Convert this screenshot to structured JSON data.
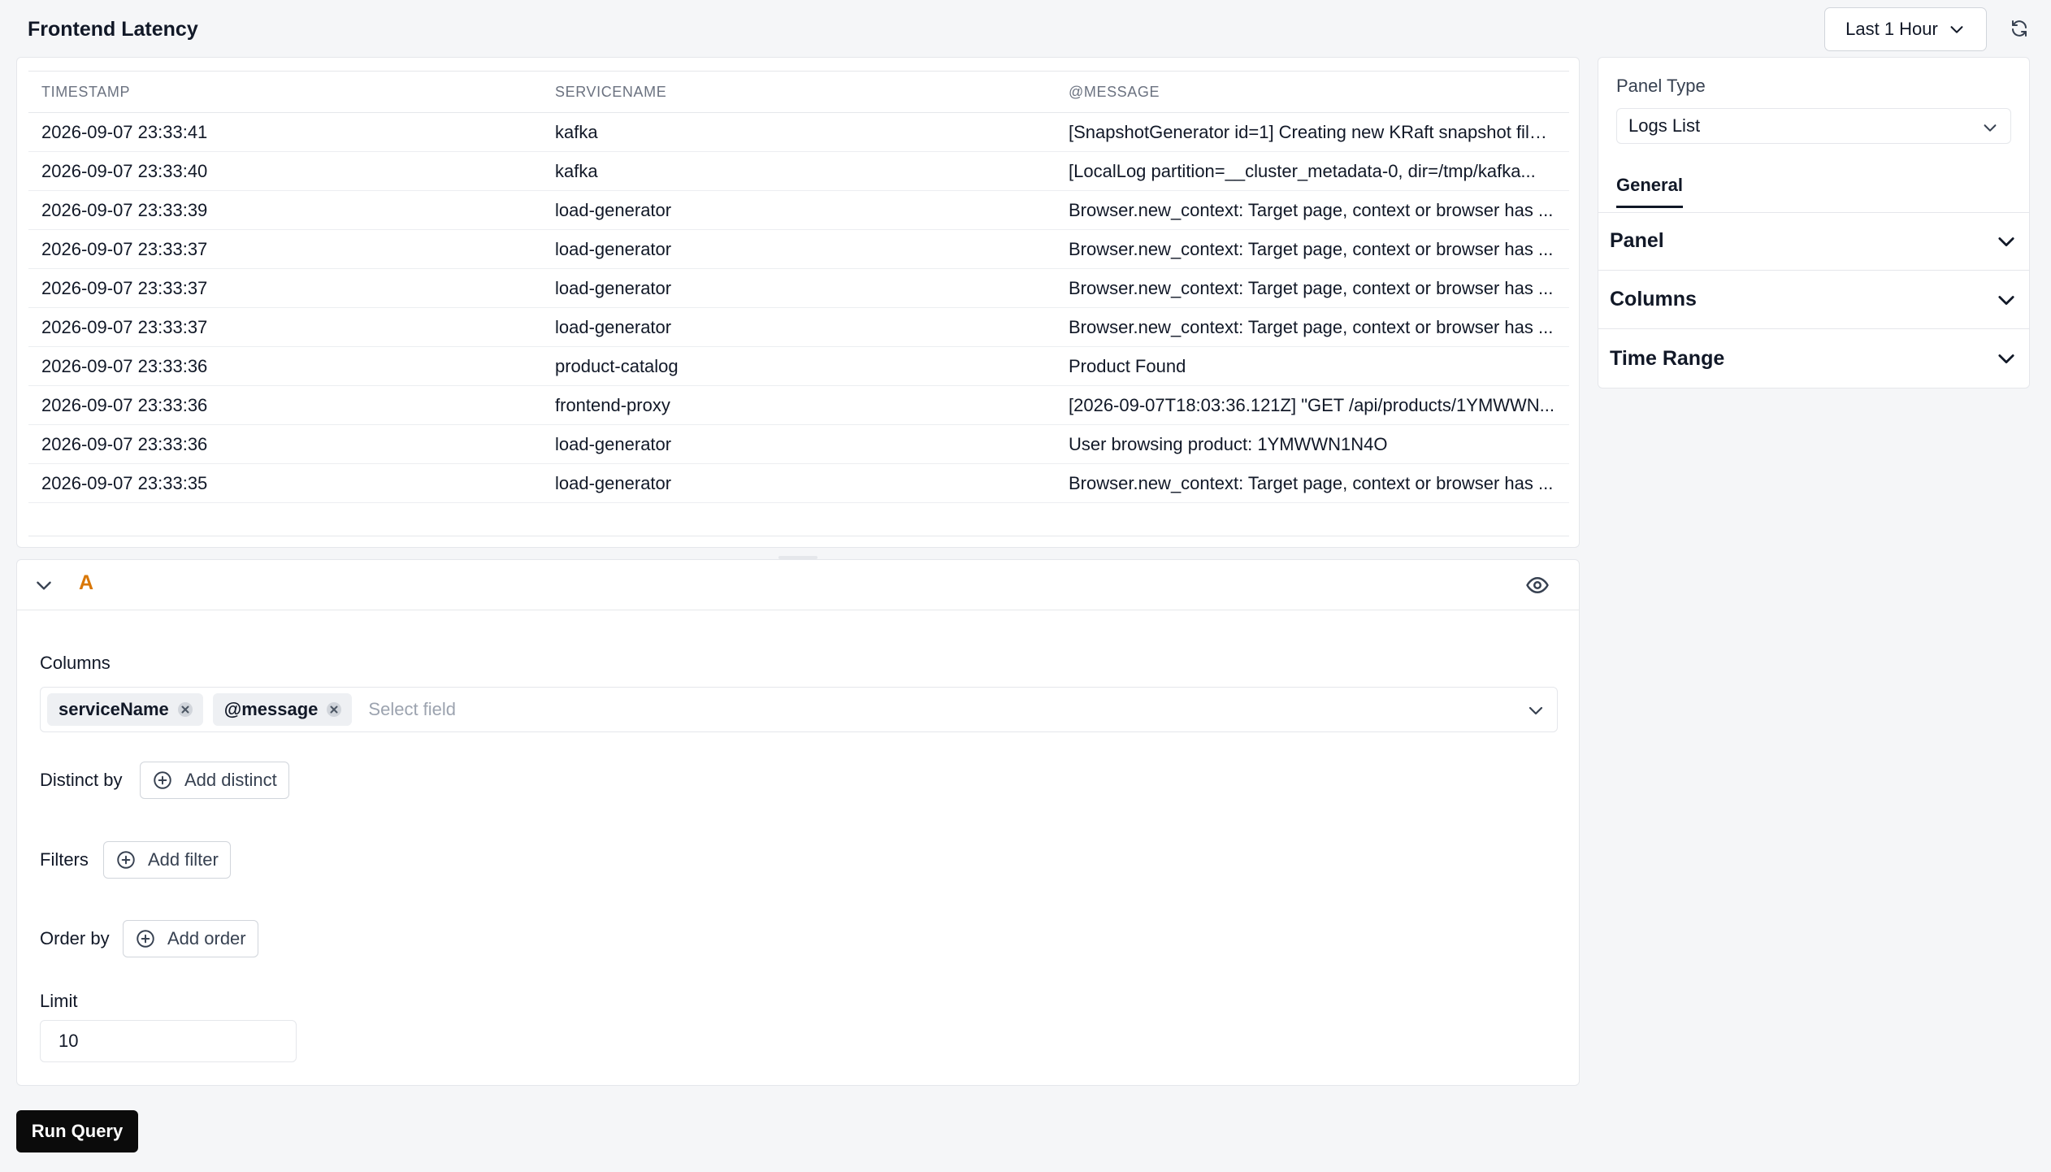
{
  "header": {
    "title": "Frontend Latency",
    "time_range": "Last 1 Hour"
  },
  "table": {
    "columns": [
      "TIMESTAMP",
      "SERVICENAME",
      "@MESSAGE"
    ],
    "rows": [
      [
        "2026-09-07 23:33:41",
        "kafka",
        "[SnapshotGenerator id=1] Creating new KRaft snapshot file ..."
      ],
      [
        "2026-09-07 23:33:40",
        "kafka",
        "[LocalLog partition=__cluster_metadata-0, dir=/tmp/kafka..."
      ],
      [
        "2026-09-07 23:33:39",
        "load-generator",
        "Browser.new_context: Target page, context or browser has ..."
      ],
      [
        "2026-09-07 23:33:37",
        "load-generator",
        "Browser.new_context: Target page, context or browser has ..."
      ],
      [
        "2026-09-07 23:33:37",
        "load-generator",
        "Browser.new_context: Target page, context or browser has ..."
      ],
      [
        "2026-09-07 23:33:37",
        "load-generator",
        "Browser.new_context: Target page, context or browser has ..."
      ],
      [
        "2026-09-07 23:33:36",
        "product-catalog",
        "Product Found"
      ],
      [
        "2026-09-07 23:33:36",
        "frontend-proxy",
        "[2026-09-07T18:03:36.121Z] \"GET /api/products/1YMWWN..."
      ],
      [
        "2026-09-07 23:33:36",
        "load-generator",
        "User browsing product: 1YMWWN1N4O"
      ],
      [
        "2026-09-07 23:33:35",
        "load-generator",
        "Browser.new_context: Target page, context or browser has ..."
      ]
    ]
  },
  "query": {
    "letter": "A",
    "columns_label": "Columns",
    "selected_columns": [
      "serviceName",
      "@message"
    ],
    "select_placeholder": "Select field",
    "distinct_label": "Distinct by",
    "add_distinct": "Add distinct",
    "filters_label": "Filters",
    "add_filter": "Add filter",
    "order_label": "Order by",
    "add_order": "Add order",
    "limit_label": "Limit",
    "limit_value": "10"
  },
  "run_button": "Run Query",
  "side_panel": {
    "panel_type_label": "Panel Type",
    "panel_type_value": "Logs List",
    "tab_general": "General",
    "sections": [
      "Panel",
      "Columns",
      "Time Range"
    ]
  },
  "colors": {
    "accent_letter": "#d97706",
    "run_button_bg": "#0b0b0b"
  },
  "icons": [
    "chevron-down-icon",
    "refresh-icon",
    "eye-icon",
    "close-circle-icon",
    "plus-circle-icon"
  ]
}
